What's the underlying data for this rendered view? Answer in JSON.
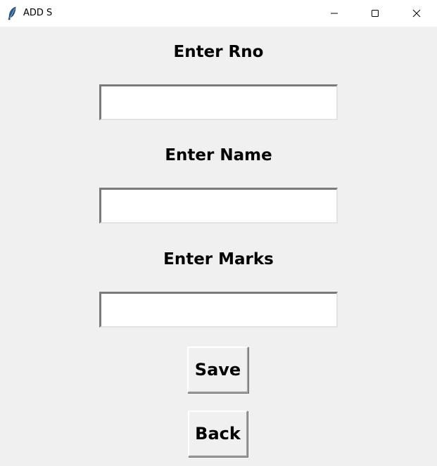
{
  "window": {
    "title": "ADD S",
    "app_icon": "feather-icon",
    "controls": [
      "minimize-icon",
      "maximize-icon",
      "close-icon"
    ]
  },
  "form": {
    "rno_label": "Enter Rno",
    "rno_value": "",
    "name_label": "Enter Name",
    "name_value": "",
    "marks_label": "Enter Marks",
    "marks_value": ""
  },
  "buttons": {
    "save_label": "Save",
    "back_label": "Back"
  }
}
